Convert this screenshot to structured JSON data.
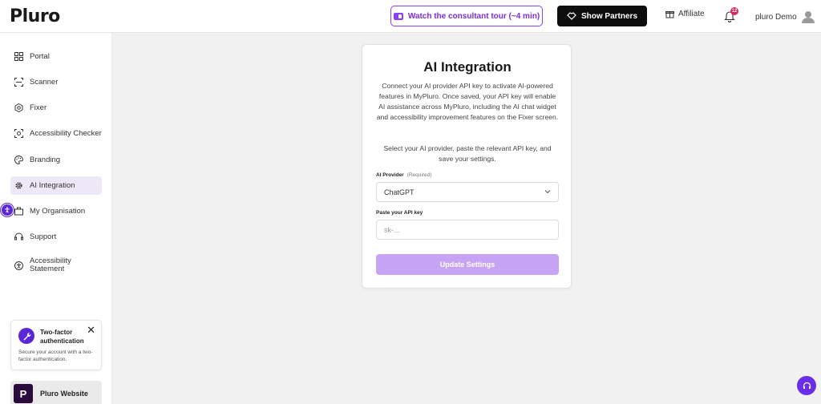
{
  "header": {
    "logo_text": "Pluro",
    "tour_button": "Watch the consultant tour (~4 min)",
    "partners_button": "Show Partners",
    "affiliate": "Affiliate",
    "notification_count": "12",
    "user_name": "pluro Demo"
  },
  "sidebar": {
    "items": [
      {
        "label": "Portal",
        "icon": "grid-icon"
      },
      {
        "label": "Scanner",
        "icon": "scan-icon"
      },
      {
        "label": "Fixer",
        "icon": "hexagon-icon"
      },
      {
        "label": "Accessibility Checker",
        "icon": "checker-icon"
      },
      {
        "label": "Branding",
        "icon": "palette-icon"
      },
      {
        "label": "AI Integration",
        "icon": "gear-icon",
        "active": true
      },
      {
        "label": "My Organisation",
        "icon": "briefcase-icon"
      },
      {
        "label": "Support",
        "icon": "headset-icon"
      },
      {
        "label": "Accessibility Statement",
        "icon": "accessibility-icon"
      }
    ],
    "twofa": {
      "title": "Two-factor authentication",
      "description": "Secure your account with a two-factor authentication."
    },
    "website": {
      "logo_letter": "P",
      "label": "Pluro Website"
    }
  },
  "main": {
    "title": "AI Integration",
    "description": "Connect your AI provider API key to activate AI-powered features in MyPluro. Once saved, your API key will enable AI assistance across MyPluro, including the AI chat widget and accessibility improvement features on the Fixer screen.",
    "instruction": "Select your AI provider, paste the relevant API key, and save your settings.",
    "provider_label": "AI Provider",
    "provider_required": "(Required)",
    "provider_value": "ChatGPT",
    "api_key_label": "Paste your API key",
    "api_key_placeholder": "sk-...",
    "update_button": "Update Settings"
  },
  "colors": {
    "accent": "#8a3ffc",
    "brand_dark": "#2b0a3d",
    "button_disabled": "#c6a4f3"
  }
}
